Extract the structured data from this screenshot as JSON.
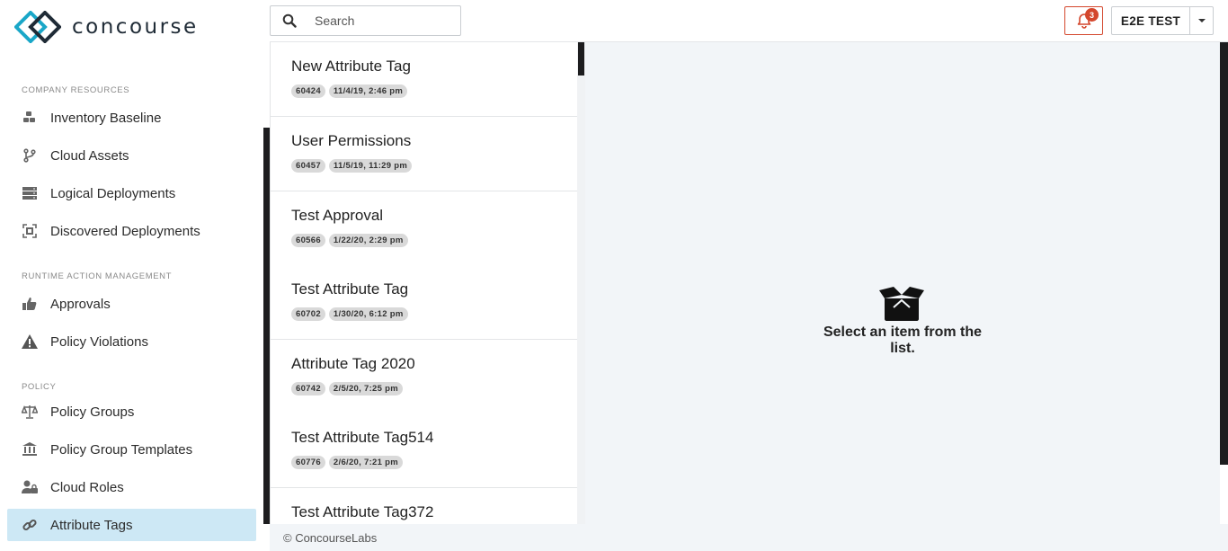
{
  "app": {
    "brand": "concourse"
  },
  "colors": {
    "accent": "#cde8f5",
    "alert": "#d4472d",
    "brand_teal": "#1aa7c8",
    "brand_dark": "#1f2b36"
  },
  "search": {
    "placeholder": "Search"
  },
  "header": {
    "notification_count": "3",
    "user_label": "E2E TEST"
  },
  "sidebar": {
    "sections": [
      {
        "heading": "COMPANY RESOURCES",
        "items": [
          {
            "label": "Inventory Baseline",
            "icon": "cubes-icon"
          },
          {
            "label": "Cloud Assets",
            "icon": "branch-icon"
          },
          {
            "label": "Logical Deployments",
            "icon": "server-stack-icon"
          },
          {
            "label": "Discovered Deployments",
            "icon": "scan-icon"
          }
        ]
      },
      {
        "heading": "RUNTIME ACTION MANAGEMENT",
        "items": [
          {
            "label": "Approvals",
            "icon": "thumbs-up-icon"
          },
          {
            "label": "Policy Violations",
            "icon": "warning-icon"
          }
        ]
      },
      {
        "heading": "POLICY",
        "items": [
          {
            "label": "Policy Groups",
            "icon": "scale-icon"
          },
          {
            "label": "Policy Group Templates",
            "icon": "bank-icon"
          },
          {
            "label": "Cloud Roles",
            "icon": "user-lock-icon"
          },
          {
            "label": "Attribute Tags",
            "icon": "link-icon",
            "active": true
          }
        ]
      }
    ]
  },
  "list": {
    "items": [
      {
        "title": "New Attribute Tag",
        "id": "60424",
        "date": "11/4/19, 2:46 pm"
      },
      {
        "title": "User Permissions",
        "id": "60457",
        "date": "11/5/19, 11:29 pm"
      },
      {
        "title": "Test Approval",
        "id": "60566",
        "date": "1/22/20, 2:29 pm"
      },
      {
        "title": "Test Attribute Tag",
        "id": "60702",
        "date": "1/30/20, 6:12 pm"
      },
      {
        "title": "Attribute Tag 2020",
        "id": "60742",
        "date": "2/5/20, 7:25 pm"
      },
      {
        "title": "Test Attribute Tag514",
        "id": "60776",
        "date": "2/6/20, 7:21 pm"
      },
      {
        "title": "Test Attribute Tag372",
        "id": "",
        "date": ""
      }
    ]
  },
  "detail": {
    "empty_message": "Select an item from the list.",
    "empty_icon": "open-box-icon"
  },
  "footer": {
    "copyright": "© ConcourseLabs"
  }
}
